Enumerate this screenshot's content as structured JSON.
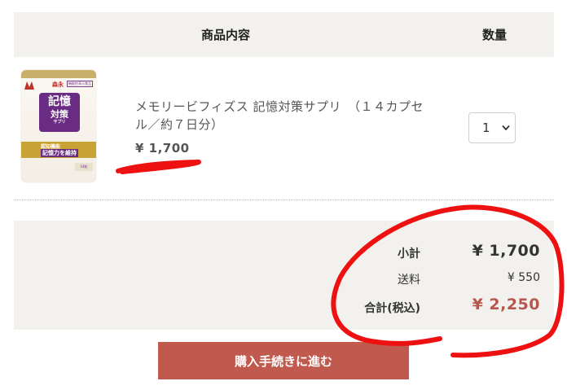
{
  "table_header": {
    "product_col": "商品内容",
    "quantity_col": "数量"
  },
  "item": {
    "name": "メモリービフィズス 記憶対策サプリ　（１４カプセル／約７日分）",
    "price": "¥ 1,700",
    "quantity": "1",
    "image": {
      "brand": "森永",
      "note": "機能性表示食品",
      "title_line1": "記憶",
      "title_line2": "対策",
      "title_line3": "サプリ",
      "band_text1": "認知機能",
      "band_text2": "記憶力を維持",
      "pill_label": "14粒"
    }
  },
  "summary": {
    "subtotal_label": "小計",
    "subtotal_value": "¥ 1,700",
    "shipping_label": "送料",
    "shipping_value": "¥ 550",
    "total_label": "合計(税込)",
    "total_value": "¥ 2,250"
  },
  "actions": {
    "purchase_label": "購入手続きに進む"
  },
  "colors": {
    "header_bg": "#f3f1ed",
    "button_bg": "#c05a4e",
    "total_color": "#b5574d",
    "annotation_red": "#ee1111"
  }
}
